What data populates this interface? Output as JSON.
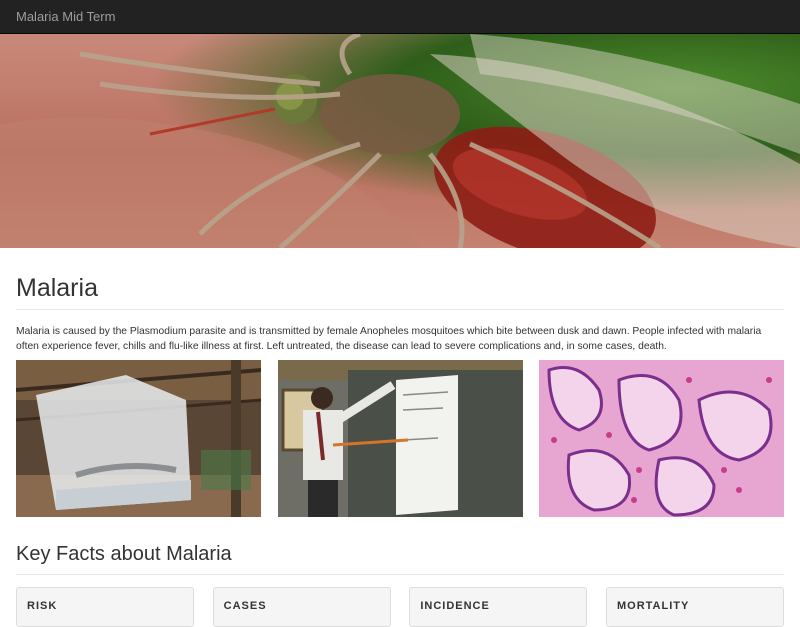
{
  "navbar": {
    "brand": "Malaria Mid Term"
  },
  "hero": {
    "image_alt": "mosquito"
  },
  "main": {
    "title": "Malaria",
    "intro": "Malaria is caused by the Plasmodium parasite and is transmitted by female Anopheles mosquitoes which bite between dusk and dawn. People infected with malaria often experience fever, chills and flu-like illness at first. Left untreated, the disease can lead to severe complications and, in some cases, death.",
    "gallery": [
      {
        "alt": "mosquito net"
      },
      {
        "alt": "teacher at whiteboard"
      },
      {
        "alt": "tissue micrograph"
      }
    ]
  },
  "facts": {
    "title": "Key Facts about Malaria",
    "cards": [
      {
        "label": "RISK"
      },
      {
        "label": "CASES"
      },
      {
        "label": "INCIDENCE"
      },
      {
        "label": "MORTALITY"
      }
    ]
  }
}
